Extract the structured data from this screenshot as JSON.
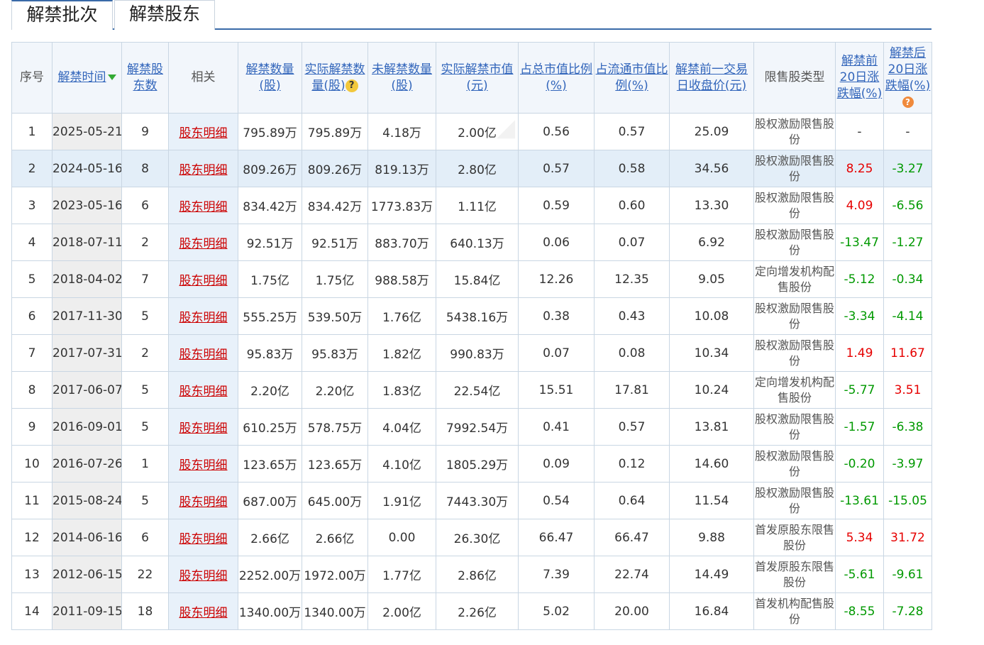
{
  "tabs": [
    {
      "label": "解禁批次"
    },
    {
      "label": "解禁股东"
    }
  ],
  "table": {
    "headers": {
      "seq": "序号",
      "date": "解禁时间",
      "holders": "解禁股东数",
      "related": "相关",
      "qty": "解禁数量(股)",
      "actual_qty": "实际解禁数量(股)",
      "remaining": "未解禁数量(股)",
      "actual_value": "实际解禁市值(元)",
      "total_ratio": "占总市值比例(%)",
      "float_ratio": "占流通市值比例(%)",
      "prev_close": "解禁前一交易日收盘价(元)",
      "type": "限售股类型",
      "pre20": "解禁前20日涨跌幅(%)",
      "post20": "解禁后20日涨跌幅(%)"
    },
    "rows": [
      {
        "seq": "1",
        "date": "2025-05-21",
        "holders": "9",
        "related": "股东明细",
        "qty": "795.89万",
        "actual_qty": "795.89万",
        "remaining": "4.18万",
        "actual_value": "2.00亿",
        "total_ratio": "0.56",
        "float_ratio": "0.57",
        "prev_close": "25.09",
        "type": "股权激励限售股份",
        "pre20": "-",
        "post20": "-"
      },
      {
        "seq": "2",
        "date": "2024-05-16",
        "holders": "8",
        "related": "股东明细",
        "qty": "809.26万",
        "actual_qty": "809.26万",
        "remaining": "819.13万",
        "actual_value": "2.80亿",
        "total_ratio": "0.57",
        "float_ratio": "0.58",
        "prev_close": "34.56",
        "type": "股权激励限售股份",
        "pre20": "8.25",
        "post20": "-3.27"
      },
      {
        "seq": "3",
        "date": "2023-05-16",
        "holders": "6",
        "related": "股东明细",
        "qty": "834.42万",
        "actual_qty": "834.42万",
        "remaining": "1773.83万",
        "actual_value": "1.11亿",
        "total_ratio": "0.59",
        "float_ratio": "0.60",
        "prev_close": "13.30",
        "type": "股权激励限售股份",
        "pre20": "4.09",
        "post20": "-6.56"
      },
      {
        "seq": "4",
        "date": "2018-07-11",
        "holders": "2",
        "related": "股东明细",
        "qty": "92.51万",
        "actual_qty": "92.51万",
        "remaining": "883.70万",
        "actual_value": "640.13万",
        "total_ratio": "0.06",
        "float_ratio": "0.07",
        "prev_close": "6.92",
        "type": "股权激励限售股份",
        "pre20": "-13.47",
        "post20": "-1.27"
      },
      {
        "seq": "5",
        "date": "2018-04-02",
        "holders": "7",
        "related": "股东明细",
        "qty": "1.75亿",
        "actual_qty": "1.75亿",
        "remaining": "988.58万",
        "actual_value": "15.84亿",
        "total_ratio": "12.26",
        "float_ratio": "12.35",
        "prev_close": "9.05",
        "type": "定向增发机构配售股份",
        "pre20": "-5.12",
        "post20": "-0.34"
      },
      {
        "seq": "6",
        "date": "2017-11-30",
        "holders": "5",
        "related": "股东明细",
        "qty": "555.25万",
        "actual_qty": "539.50万",
        "remaining": "1.76亿",
        "actual_value": "5438.16万",
        "total_ratio": "0.38",
        "float_ratio": "0.43",
        "prev_close": "10.08",
        "type": "股权激励限售股份",
        "pre20": "-3.34",
        "post20": "-4.14"
      },
      {
        "seq": "7",
        "date": "2017-07-31",
        "holders": "2",
        "related": "股东明细",
        "qty": "95.83万",
        "actual_qty": "95.83万",
        "remaining": "1.82亿",
        "actual_value": "990.83万",
        "total_ratio": "0.07",
        "float_ratio": "0.08",
        "prev_close": "10.34",
        "type": "股权激励限售股份",
        "pre20": "1.49",
        "post20": "11.67"
      },
      {
        "seq": "8",
        "date": "2017-06-07",
        "holders": "5",
        "related": "股东明细",
        "qty": "2.20亿",
        "actual_qty": "2.20亿",
        "remaining": "1.83亿",
        "actual_value": "22.54亿",
        "total_ratio": "15.51",
        "float_ratio": "17.81",
        "prev_close": "10.24",
        "type": "定向增发机构配售股份",
        "pre20": "-5.77",
        "post20": "3.51"
      },
      {
        "seq": "9",
        "date": "2016-09-01",
        "holders": "5",
        "related": "股东明细",
        "qty": "610.25万",
        "actual_qty": "578.75万",
        "remaining": "4.04亿",
        "actual_value": "7992.54万",
        "total_ratio": "0.41",
        "float_ratio": "0.57",
        "prev_close": "13.81",
        "type": "股权激励限售股份",
        "pre20": "-1.57",
        "post20": "-6.38"
      },
      {
        "seq": "10",
        "date": "2016-07-26",
        "holders": "1",
        "related": "股东明细",
        "qty": "123.65万",
        "actual_qty": "123.65万",
        "remaining": "4.10亿",
        "actual_value": "1805.29万",
        "total_ratio": "0.09",
        "float_ratio": "0.12",
        "prev_close": "14.60",
        "type": "股权激励限售股份",
        "pre20": "-0.20",
        "post20": "-3.97"
      },
      {
        "seq": "11",
        "date": "2015-08-24",
        "holders": "5",
        "related": "股东明细",
        "qty": "687.00万",
        "actual_qty": "645.00万",
        "remaining": "1.91亿",
        "actual_value": "7443.30万",
        "total_ratio": "0.54",
        "float_ratio": "0.64",
        "prev_close": "11.54",
        "type": "股权激励限售股份",
        "pre20": "-13.61",
        "post20": "-15.05"
      },
      {
        "seq": "12",
        "date": "2014-06-16",
        "holders": "6",
        "related": "股东明细",
        "qty": "2.66亿",
        "actual_qty": "2.66亿",
        "remaining": "0.00",
        "actual_value": "26.30亿",
        "total_ratio": "66.47",
        "float_ratio": "66.47",
        "prev_close": "9.88",
        "type": "首发原股东限售股份",
        "pre20": "5.34",
        "post20": "31.72"
      },
      {
        "seq": "13",
        "date": "2012-06-15",
        "holders": "22",
        "related": "股东明细",
        "qty": "2252.00万",
        "actual_qty": "1972.00万",
        "remaining": "1.77亿",
        "actual_value": "2.86亿",
        "total_ratio": "7.39",
        "float_ratio": "22.74",
        "prev_close": "14.49",
        "type": "首发原股东限售股份",
        "pre20": "-5.61",
        "post20": "-9.61"
      },
      {
        "seq": "14",
        "date": "2011-09-15",
        "holders": "18",
        "related": "股东明细",
        "qty": "1340.00万",
        "actual_qty": "1340.00万",
        "remaining": "2.00亿",
        "actual_value": "2.26亿",
        "total_ratio": "5.02",
        "float_ratio": "20.00",
        "prev_close": "16.84",
        "type": "首发机构配售股份",
        "pre20": "-8.55",
        "post20": "-7.28"
      }
    ]
  },
  "icons": {
    "sort": "sort-desc-icon",
    "help": "help-icon"
  },
  "colors": {
    "up": "#e60000",
    "down": "#009900",
    "link": "#cc0000",
    "header_link": "#3366bb"
  }
}
